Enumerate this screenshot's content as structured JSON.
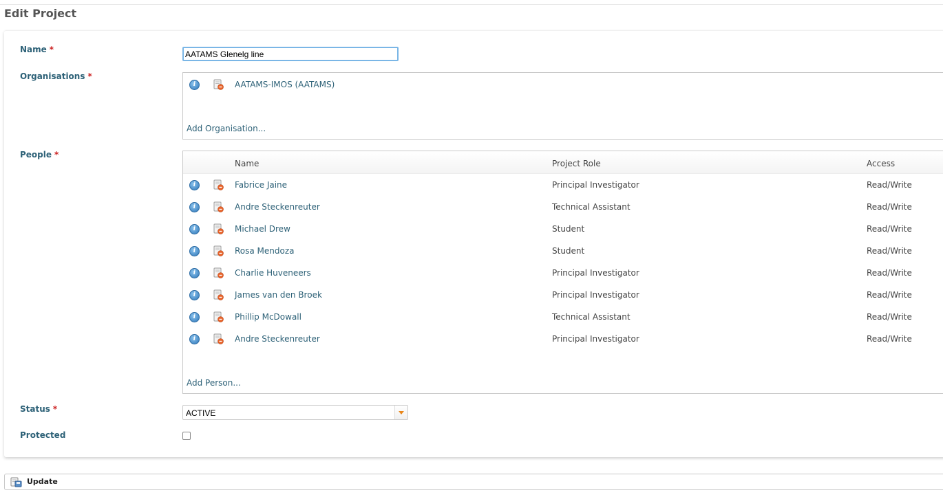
{
  "page": {
    "title": "Edit Project"
  },
  "form": {
    "name": {
      "label": "Name",
      "required_mark": "*",
      "value": "AATAMS Glenelg line"
    },
    "organisations": {
      "label": "Organisations",
      "required_mark": "*",
      "items": [
        {
          "name": "AATAMS-IMOS (AATAMS)"
        }
      ],
      "add_label": "Add Organisation..."
    },
    "people": {
      "label": "People",
      "required_mark": "*",
      "columns": {
        "name": "Name",
        "role": "Project Role",
        "access": "Access"
      },
      "rows": [
        {
          "name": "Fabrice Jaine",
          "role": "Principal Investigator",
          "access": "Read/Write"
        },
        {
          "name": "Andre Steckenreuter",
          "role": "Technical Assistant",
          "access": "Read/Write"
        },
        {
          "name": "Michael Drew",
          "role": "Student",
          "access": "Read/Write"
        },
        {
          "name": "Rosa Mendoza",
          "role": "Student",
          "access": "Read/Write"
        },
        {
          "name": "Charlie Huveneers",
          "role": "Principal Investigator",
          "access": "Read/Write"
        },
        {
          "name": "James van den Broek",
          "role": "Principal Investigator",
          "access": "Read/Write"
        },
        {
          "name": "Phillip McDowall",
          "role": "Technical Assistant",
          "access": "Read/Write"
        },
        {
          "name": "Andre Steckenreuter",
          "role": "Principal Investigator",
          "access": "Read/Write"
        }
      ],
      "add_label": "Add Person..."
    },
    "status": {
      "label": "Status",
      "required_mark": "*",
      "value": "ACTIVE"
    },
    "protected": {
      "label": "Protected",
      "checked": false
    }
  },
  "actions": {
    "update_label": "Update"
  },
  "icons": {
    "info": "info-icon",
    "delete": "delete-icon",
    "update": "update-icon",
    "dropdown": "chevron-down-icon"
  },
  "colors": {
    "label": "#2d6177",
    "required": "#cc2222",
    "focus": "#7ab6e6",
    "dropdown_arrow": "#e8861a"
  }
}
